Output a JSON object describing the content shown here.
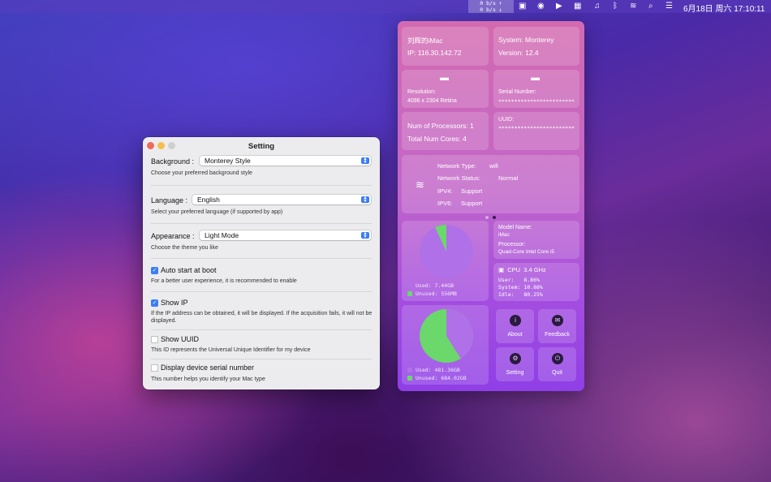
{
  "menubar": {
    "net_up": "0 b/s ↑",
    "net_down": "0 b/s ↓",
    "datetime": "6月18日 周六  17:10:11",
    "icons": [
      "monitor-icon",
      "app-icon",
      "play-icon",
      "grid-icon",
      "headphones-icon",
      "bluetooth-icon",
      "wifi-icon",
      "search-icon",
      "control-center-icon"
    ]
  },
  "settings": {
    "title": "Setting",
    "background": {
      "label": "Background :",
      "value": "Monterey Style",
      "hint": "Choose your preferred background style"
    },
    "language": {
      "label": "Language :",
      "value": "English",
      "hint": "Select your preferred language (if supported by app)"
    },
    "appearance": {
      "label": "Appearance :",
      "value": "Light Mode",
      "hint": "Choose the theme you like"
    },
    "auto_start": {
      "label": "Auto start at boot",
      "checked": true,
      "hint": "For a better user experience, it is recommended to enable"
    },
    "show_ip": {
      "label": "Show IP",
      "checked": true,
      "hint": "If the IP address can be obtained, it will be displayed. If the acquisition fails, it will not be displayed."
    },
    "show_uuid": {
      "label": "Show UUID",
      "checked": false,
      "hint": "This ID represents the Universal Unique Identifier for my device"
    },
    "serial": {
      "label": "Display device serial number",
      "checked": false,
      "hint": "This number helps you identify your Mac type"
    }
  },
  "panel": {
    "device_name": "刘辉的iMac",
    "ip": "IP: 116.30.142.72",
    "system": "System: Monterey",
    "version": "Version: 12.4",
    "resolution_label": "Resolution:",
    "resolution_value": "4096 x 2304 Retina",
    "serial_label": "Serial Number:",
    "serial_value": "************************",
    "processors": "Num of Processors: 1",
    "cores": "Total Num Cores: 4",
    "uuid_label": "UUID:",
    "uuid_value": "************************",
    "network": {
      "type_label": "Network Type:",
      "type": "wifi",
      "status_label": "Network Status:",
      "status": "Normal",
      "ipv4_label": "IPV4:",
      "ipv4": "Support",
      "ipv6_label": "IPV6:",
      "ipv6": "Support"
    },
    "memory": {
      "used_label": "Used:",
      "used": "7.44GB",
      "unused_label": "Unused:",
      "unused": "556MB",
      "used_fraction": 0.93
    },
    "model": {
      "name_label": "Model Name:",
      "name": "iMac",
      "processor_label": "Processor:",
      "processor": "Quad-Core Intel Core i5"
    },
    "cpu": {
      "label": "CPU",
      "freq": "3.4 GHz",
      "user_label": "User:",
      "user": "8.86%",
      "system_label": "System:",
      "system": "10.88%",
      "idle_label": "Idle:",
      "idle": "80.25%"
    },
    "disk": {
      "used_label": "Used:",
      "used": "481.36GB",
      "unused_label": "Unused:",
      "unused": "684.02GB",
      "used_fraction": 0.41
    },
    "buttons": {
      "about": "About",
      "feedback": "Feedback",
      "setting": "Setting",
      "quit": "Quit"
    },
    "colors": {
      "used": "#b070e8",
      "unused": "#6ad86a"
    }
  }
}
